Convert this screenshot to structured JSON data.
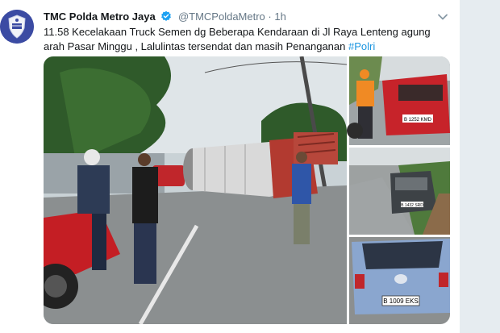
{
  "tweet": {
    "display_name": "TMC Polda Metro Jaya",
    "handle": "@TMCPoldaMetro",
    "separator": "·",
    "time": "1h",
    "text_before": "11.58 Kecelakaan Truck Semen dg Beberapa Kendaraan  di Jl Raya Lenteng agung arah Pasar Minggu , Lalulintas tersendat dan masih Penanganan ",
    "hashtag": "#Polri"
  },
  "photos": {
    "plate_top": "B 1252 KMD",
    "plate_middle": "B 1432 SRD",
    "plate_bottom": "B 1009 EKS"
  },
  "icons": {
    "avatar": "police-emblem-icon",
    "verified": "verified-badge-icon",
    "caret": "chevron-down-icon"
  },
  "colors": {
    "link": "#1b95e0",
    "verified": "#1da1f2",
    "text": "#14171a",
    "muted": "#657786"
  }
}
